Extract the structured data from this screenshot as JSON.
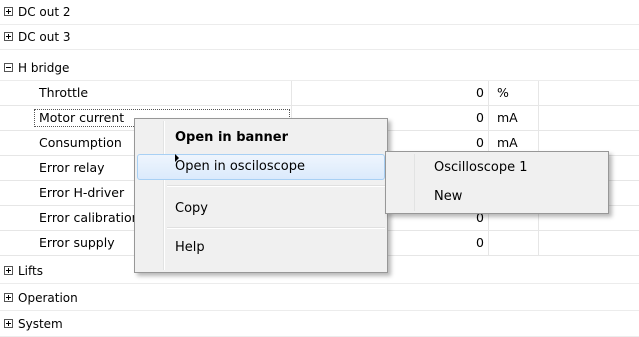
{
  "groups_top": [
    {
      "label": "DC out 2",
      "expanded": false
    },
    {
      "label": "DC out 3",
      "expanded": false
    },
    {
      "label": "H bridge",
      "expanded": true
    }
  ],
  "rows": [
    {
      "name": "Throttle",
      "value": "0",
      "unit": "%"
    },
    {
      "name": "Motor current",
      "value": "0",
      "unit": "mA"
    },
    {
      "name": "Consumption",
      "value": "0",
      "unit": "mA"
    },
    {
      "name": "Error relay",
      "value": "",
      "unit": ""
    },
    {
      "name": "Error H-driver",
      "value": "",
      "unit": ""
    },
    {
      "name": "Error calibration",
      "value": "0",
      "unit": ""
    },
    {
      "name": "Error supply",
      "value": "0",
      "unit": ""
    }
  ],
  "groups_bottom": [
    {
      "label": "Lifts",
      "expanded": false
    },
    {
      "label": "Operation",
      "expanded": false
    },
    {
      "label": "System",
      "expanded": false
    }
  ],
  "context_menu": {
    "open_in_banner": "Open in banner",
    "open_in_oscilloscope": "Open in osciloscope",
    "copy": "Copy",
    "help": "Help"
  },
  "submenu": {
    "items": [
      "Oscilloscope 1",
      "New"
    ]
  }
}
